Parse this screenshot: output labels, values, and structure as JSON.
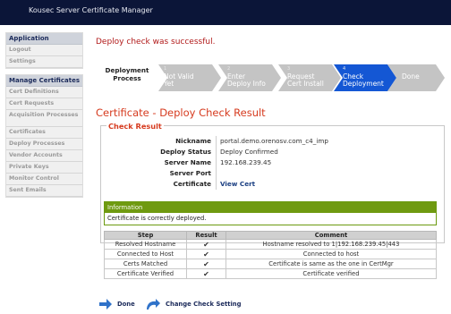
{
  "header": {
    "title": "Kousec Server Certificate Manager"
  },
  "sidebar": {
    "groups": [
      {
        "heading": "Application",
        "items": [
          "Logout",
          "Settings"
        ]
      },
      {
        "heading": "Manage Certificates",
        "items": [
          "Cert Definitions",
          "Cert Requests",
          "Acquisition Processes",
          "Certificates",
          "Deploy Processes",
          "Vendor Accounts",
          "Private Keys",
          "Monitor Control",
          "Sent Emails"
        ]
      }
    ]
  },
  "message": "Deploy check was successful.",
  "wizard": {
    "label_line1": "Deployment",
    "label_line2": "Process",
    "steps": [
      {
        "num": "1",
        "line1": "Not Valid",
        "line2": "Yet"
      },
      {
        "num": "2",
        "line1": "Enter",
        "line2": "Deploy Info"
      },
      {
        "num": "3",
        "line1": "Request",
        "line2": "Cert Install"
      },
      {
        "num": "4",
        "line1": "Check",
        "line2": "Deployment"
      },
      {
        "num": "",
        "line1": "Done",
        "line2": ""
      }
    ],
    "colors": {
      "inactive": "#c4c4c4",
      "active": "#1457d4"
    }
  },
  "section_title": "Certificate - Deploy Check Result",
  "check_result": {
    "legend": "Check Result",
    "fields": [
      {
        "label": "Nickname",
        "value": "portal.demo.orenosv.com_c4_imp"
      },
      {
        "label": "Deploy Status",
        "value": "Deploy Confirmed"
      },
      {
        "label": "Server Name",
        "value": "192.168.239.45"
      },
      {
        "label": "Server Port",
        "value": ""
      },
      {
        "label": "Certificate",
        "value": "View Cert"
      }
    ]
  },
  "info": {
    "heading": "Information",
    "body": "Certificate is correctly deployed."
  },
  "steps_table": {
    "headers": [
      "Step",
      "Result",
      "Comment"
    ],
    "rows": [
      {
        "step": "Resolved Hostname",
        "result": "✔",
        "comment": "Hostname resolved to 1|192.168.239.45|443"
      },
      {
        "step": "Connected to Host",
        "result": "✔",
        "comment": "Connected to host"
      },
      {
        "step": "Certs Matched",
        "result": "✔",
        "comment": "Certificate is same as the one in CertMgr"
      },
      {
        "step": "Certificate Verified",
        "result": "✔",
        "comment": "Certificate verified"
      }
    ]
  },
  "actions": {
    "done": "Done",
    "change": "Change Check Setting"
  }
}
